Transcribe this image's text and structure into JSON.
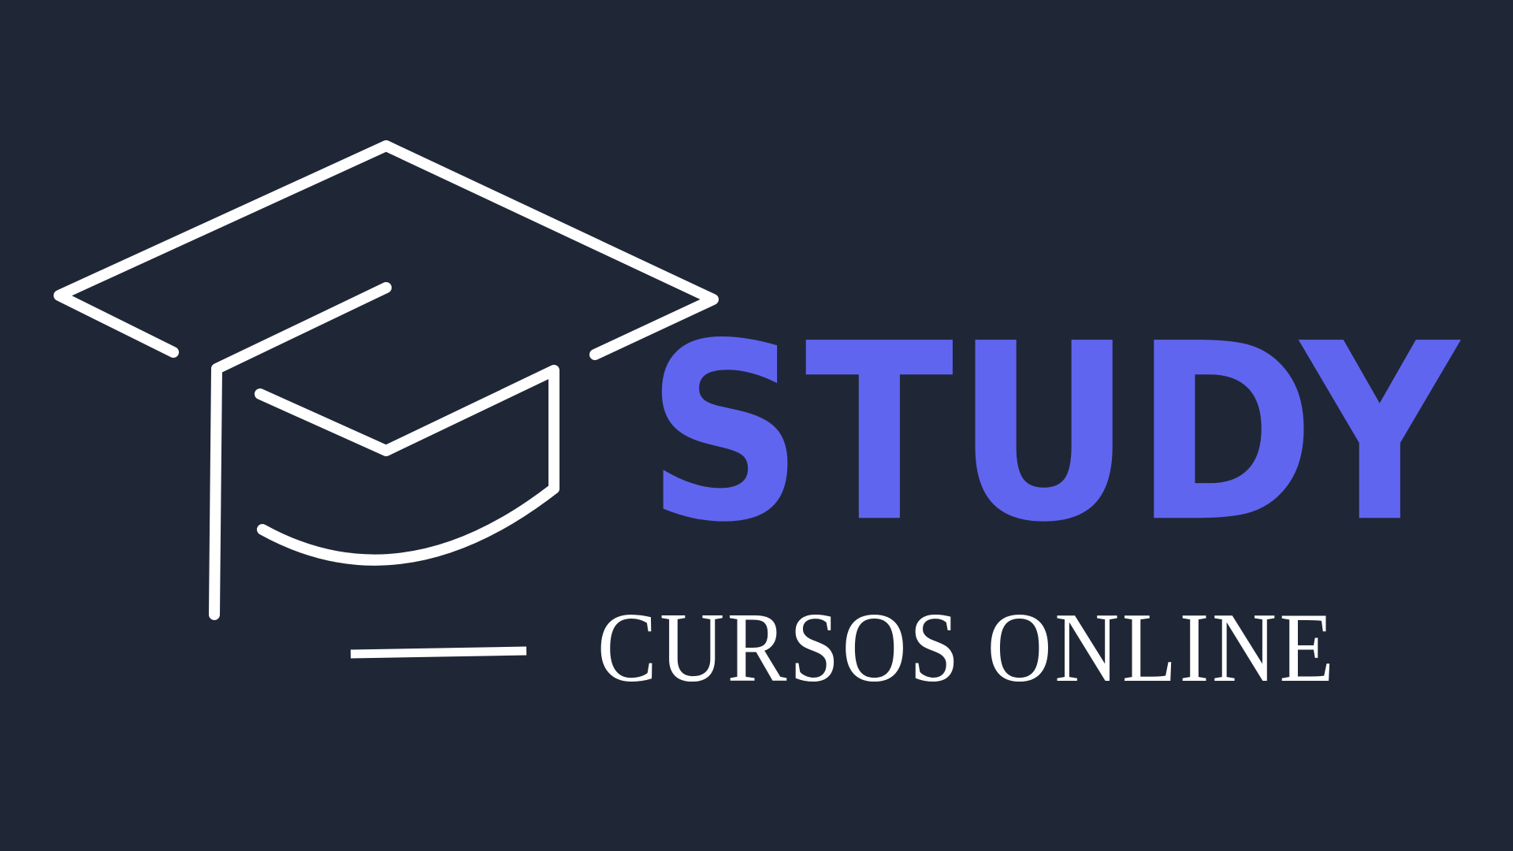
{
  "brand": {
    "name": "STUDY",
    "tagline": "CURSOS ONLINE"
  },
  "icons": {
    "logo": "graduation-cap-icon",
    "divider": "dash-line"
  },
  "colors": {
    "background": "#1f2737",
    "accent": "#6065f0",
    "foreground": "#ffffff"
  }
}
